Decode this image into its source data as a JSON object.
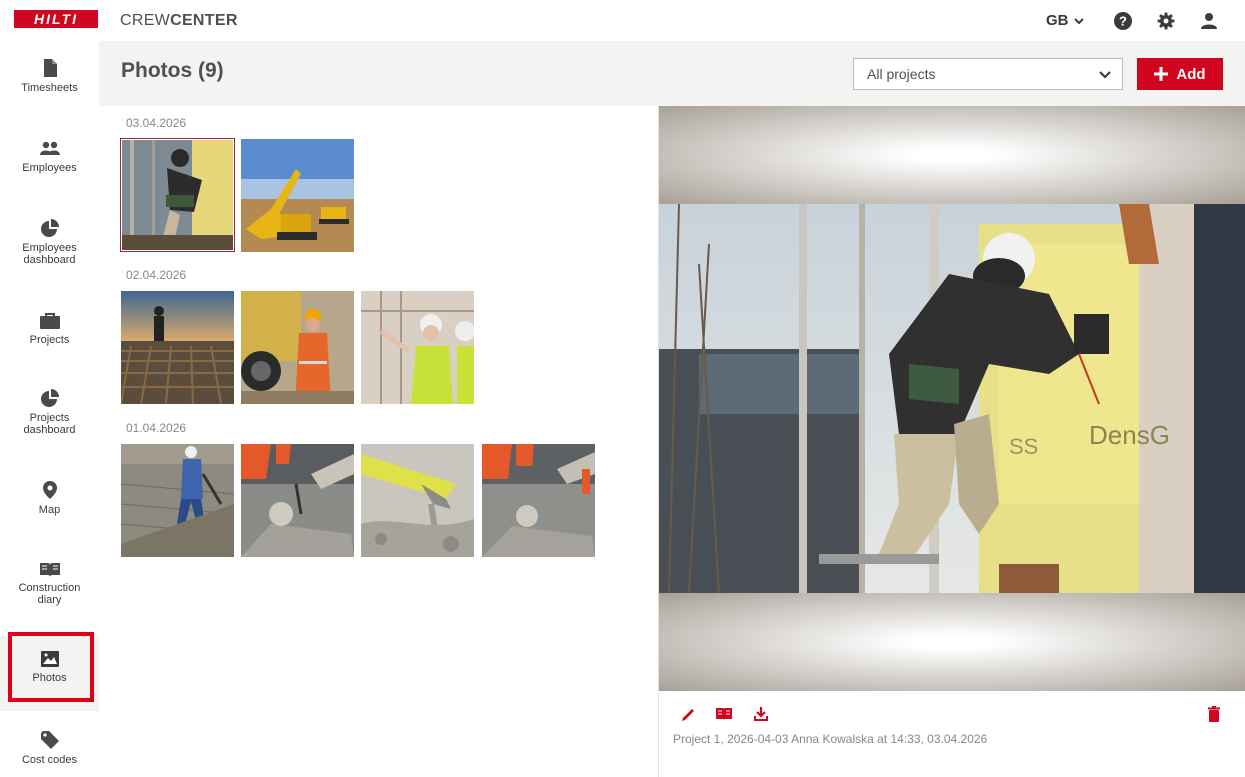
{
  "app": {
    "brand_logo": "HILTI",
    "brand_light": "CREW",
    "brand_bold": "CENTER",
    "accent": "#d2051e"
  },
  "topbar": {
    "language": "GB",
    "icons": [
      "help-icon",
      "settings-icon",
      "user-icon"
    ]
  },
  "sidebar": {
    "items": [
      {
        "label": "Timesheets",
        "icon": "document-icon"
      },
      {
        "label": "Employees",
        "icon": "people-icon"
      },
      {
        "label": "Employees dashboard",
        "icon": "pie-chart-icon"
      },
      {
        "label": "Projects",
        "icon": "briefcase-icon"
      },
      {
        "label": "Projects dashboard",
        "icon": "pie-chart-icon"
      },
      {
        "label": "Map",
        "icon": "location-pin-icon"
      },
      {
        "label": "Construction diary",
        "icon": "book-icon"
      },
      {
        "label": "Photos",
        "icon": "image-icon",
        "active": true
      },
      {
        "label": "Cost codes",
        "icon": "tag-icon"
      }
    ]
  },
  "header": {
    "title": "Photos (9)",
    "project_filter": "All projects",
    "add_label": "Add"
  },
  "gallery": {
    "groups": [
      {
        "date": "03.04.2026",
        "photos": [
          "worker on scaffold with nail gun",
          "yellow excavator on dirt site"
        ]
      },
      {
        "date": "02.04.2026",
        "photos": [
          "rebar grid with workers",
          "worker in orange suit by loader",
          "female engineer pointing"
        ]
      },
      {
        "date": "01.04.2026",
        "photos": [
          "worker spraying concrete",
          "workers pouring concrete",
          "concrete chute pouring",
          "workers pouring concrete close-up"
        ]
      }
    ]
  },
  "viewer": {
    "caption": "Project 1, 2026-04-03 Anna Kowalska at 14:33, 03.04.2026",
    "actions": [
      "edit-icon",
      "diary-icon",
      "download-icon",
      "delete-icon"
    ]
  }
}
